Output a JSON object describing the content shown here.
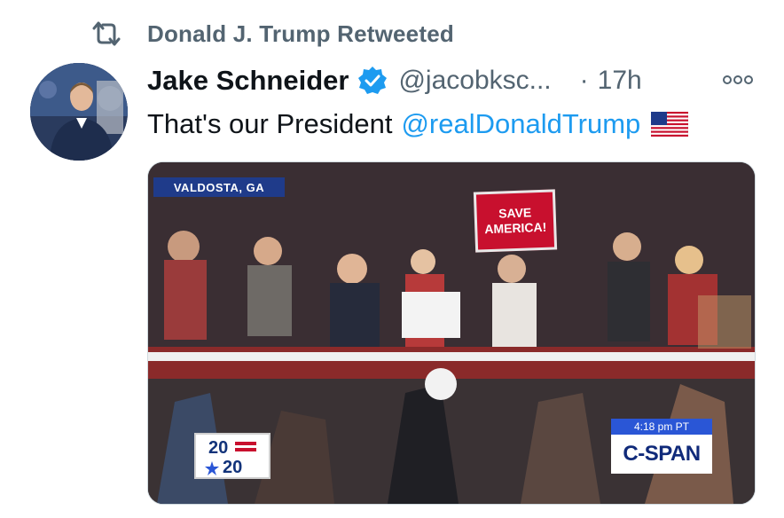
{
  "retweet": {
    "icon": "retweet-icon",
    "label": "Donald J. Trump Retweeted"
  },
  "tweet": {
    "author_name": "Jake Schneider",
    "author_handle": "@jacobksc...",
    "time_separator": "·",
    "time": "17h",
    "verified_icon": "verified-badge-icon",
    "more_icon": "more-options-icon",
    "text": "That's our President",
    "mention": "@realDonaldTrump",
    "emoji": "us-flag-emoji"
  },
  "media": {
    "location_caption": "VALDOSTA, GA",
    "sign_line1": "SAVE",
    "sign_line2": "AMERICA!",
    "timestamp": "4:18 pm PT",
    "network": "C-SPAN",
    "logo_top": "20",
    "logo_bottom": "20"
  },
  "colors": {
    "link": "#1d9bf0",
    "secondary_text": "#536471",
    "verified": "#1d9bf0"
  }
}
